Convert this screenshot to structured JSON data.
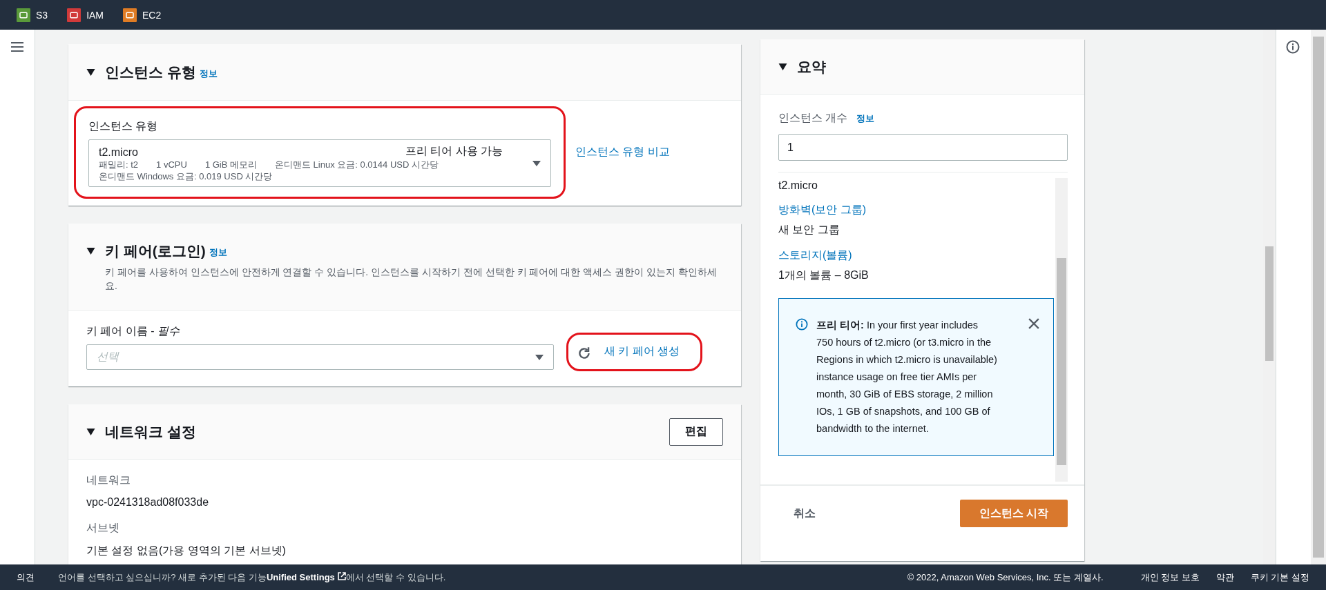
{
  "top_nav": {
    "services": [
      {
        "label": "S3",
        "color": "#5a9a3a"
      },
      {
        "label": "IAM",
        "color": "#d13a3a"
      },
      {
        "label": "EC2",
        "color": "#e07c24"
      }
    ]
  },
  "instance_type": {
    "title": "인스턴스 유형",
    "info_link": "정보",
    "expanded": true,
    "highlighted": true,
    "field_label": "인스턴스 유형",
    "value": "t2.micro",
    "badge": "프리 티어 사용 가능",
    "details": [
      "패밀리: t2",
      "1 vCPU",
      "1 GiB 메모리",
      "온디맨드 Linux 요금: 0.0144 USD 시간당",
      "온디맨드 Windows 요금: 0.019 USD 시간당"
    ],
    "compare_link": "인스턴스 유형 비교"
  },
  "key_pair": {
    "title": "키 페어(로그인)",
    "info_link": "정보",
    "expanded": true,
    "description": "키 페어를 사용하여 인스턴스에 안전하게 연결할 수 있습니다. 인스턴스를 시작하기 전에 선택한 키 페어에 대한 액세스 권한이 있는지 확인하세요.",
    "field_label": "키 페어 이름 - *필수*",
    "placeholder": "선택",
    "create_link": "새 키 페어 생성",
    "highlighted": true
  },
  "network": {
    "title": "네트워크 설정",
    "expanded": true,
    "edit_button": "편집",
    "fields": [
      {
        "label": "네트워크",
        "value": "vpc-0241318ad08f033de"
      },
      {
        "label": "서브넷",
        "value": "기본 설정 없음(가용 영역의 기본 서브넷)"
      }
    ]
  },
  "summary": {
    "title": "요약",
    "expanded": true,
    "count_label": "인스턴스 개수",
    "count_info": "정보",
    "count_value": "1",
    "lines": [
      {
        "kind": "value",
        "text": "t2.micro"
      },
      {
        "kind": "link",
        "text": "방화벽(보안 그룹)"
      },
      {
        "kind": "value",
        "text": "새 보안 그룹"
      },
      {
        "kind": "link",
        "text": "스토리지(볼륨)"
      },
      {
        "kind": "value",
        "text": "1개의 볼륨 – 8GiB"
      }
    ],
    "alert": "**프리 티어:** In your first year includes 750 hours of t2.micro (or t3.micro in the Regions in which t2.micro is unavailable) instance usage on free tier AMIs per month, 30 GiB of EBS storage, 2 million IOs, 1 GB of snapshots, and 100 GB of bandwidth to the internet.",
    "cancel": "취소",
    "launch": "인스턴스 시작"
  },
  "footer": {
    "feedback": "의견",
    "notice_before": "언어를 선택하고 싶으십니까? 새로 추가된 다음 기능",
    "notice_link": "Unified Settings",
    "notice_after": "에서 선택할 수 있습니다.",
    "copyright": "© 2022, Amazon Web Services, Inc. 또는 계열사.",
    "links": [
      "개인 정보 보호",
      "약관",
      "쿠키 기본 설정"
    ]
  }
}
